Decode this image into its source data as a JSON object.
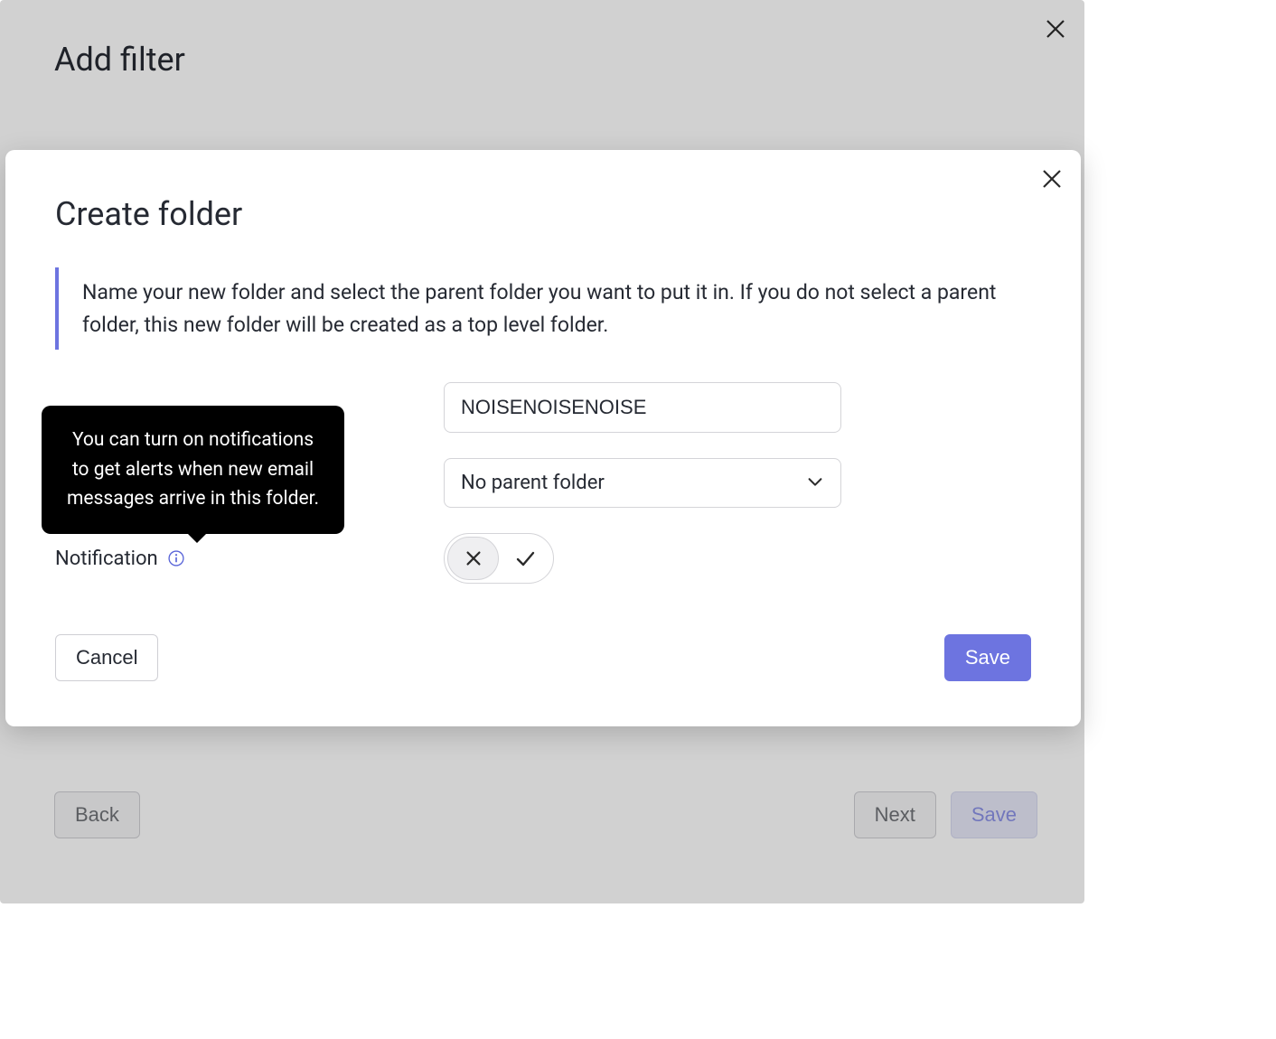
{
  "back_modal": {
    "title": "Add filter",
    "buttons": {
      "back": "Back",
      "next": "Next",
      "save": "Save"
    }
  },
  "front_modal": {
    "title": "Create folder",
    "description": "Name your new folder and select the parent folder you want to put it in. If you do not select a parent folder, this new folder will be created as a top level folder.",
    "folder_name_value": "NOISENOISENOISE",
    "parent_folder_value": "No parent folder",
    "notification_label": "Notification",
    "tooltip": "You can turn on notifications to get alerts when new email messages arrive in this folder.",
    "toggle_state": "off",
    "buttons": {
      "cancel": "Cancel",
      "save": "Save"
    }
  }
}
